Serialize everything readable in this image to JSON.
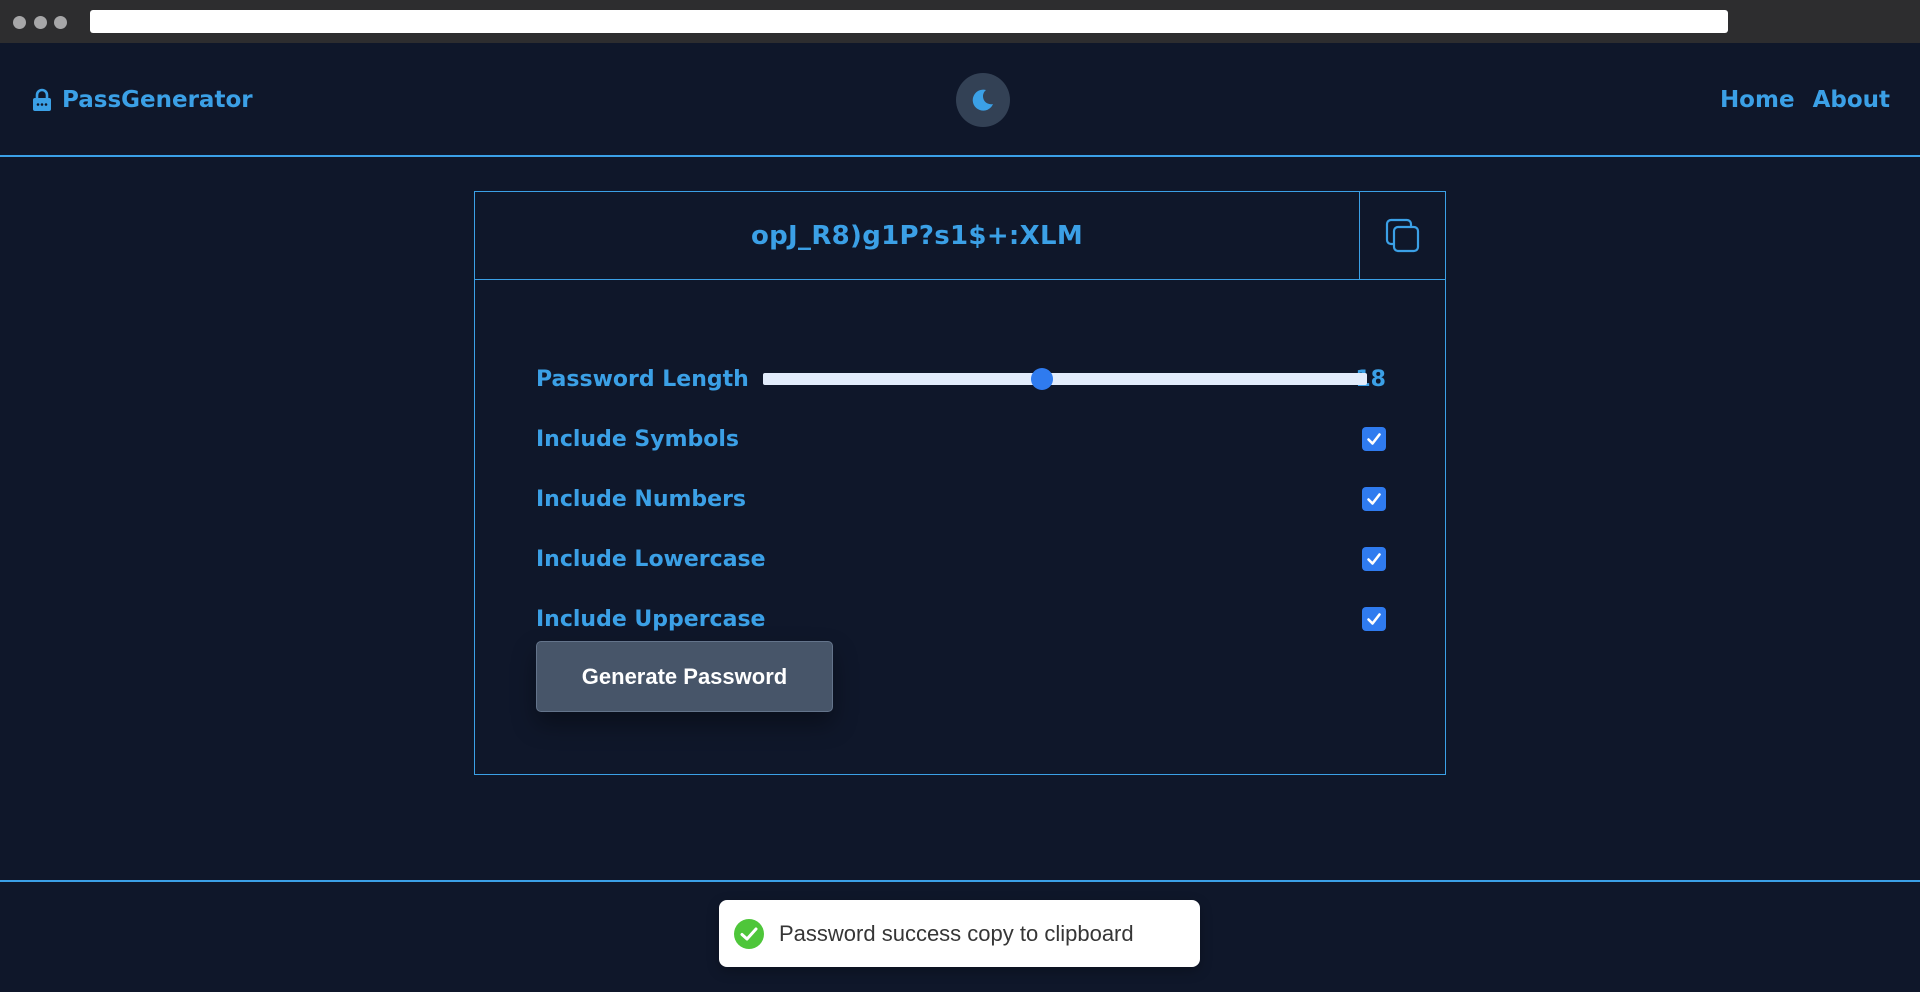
{
  "brand": {
    "name": "PassGenerator",
    "icon": "lock-icon"
  },
  "header": {
    "theme_toggle_icon": "moon-icon"
  },
  "nav": {
    "items": [
      {
        "label": "Home"
      },
      {
        "label": "About"
      }
    ]
  },
  "password": {
    "value": "opJ_R8)g1P?s1$+:XLM",
    "copy_icon": "copy-icon"
  },
  "options": {
    "length": {
      "label": "Password Length",
      "value": "18",
      "min": 8,
      "max": 28,
      "level": 0.46
    },
    "symbols": {
      "label": "Include Symbols",
      "checked": true
    },
    "numbers": {
      "label": "Include Numbers",
      "checked": true
    },
    "lowercase": {
      "label": "Include Lowercase",
      "checked": true
    },
    "uppercase": {
      "label": "Include Uppercase",
      "checked": true
    }
  },
  "actions": {
    "generate_label": "Generate Password"
  },
  "toast": {
    "message": "Password success copy to clipboard",
    "icon": "check-circle-icon"
  },
  "colors": {
    "background": "#0f172a",
    "accent": "#3ba0e6",
    "control": "#2f7bef",
    "button": "#475569",
    "success": "#4ec63a"
  }
}
